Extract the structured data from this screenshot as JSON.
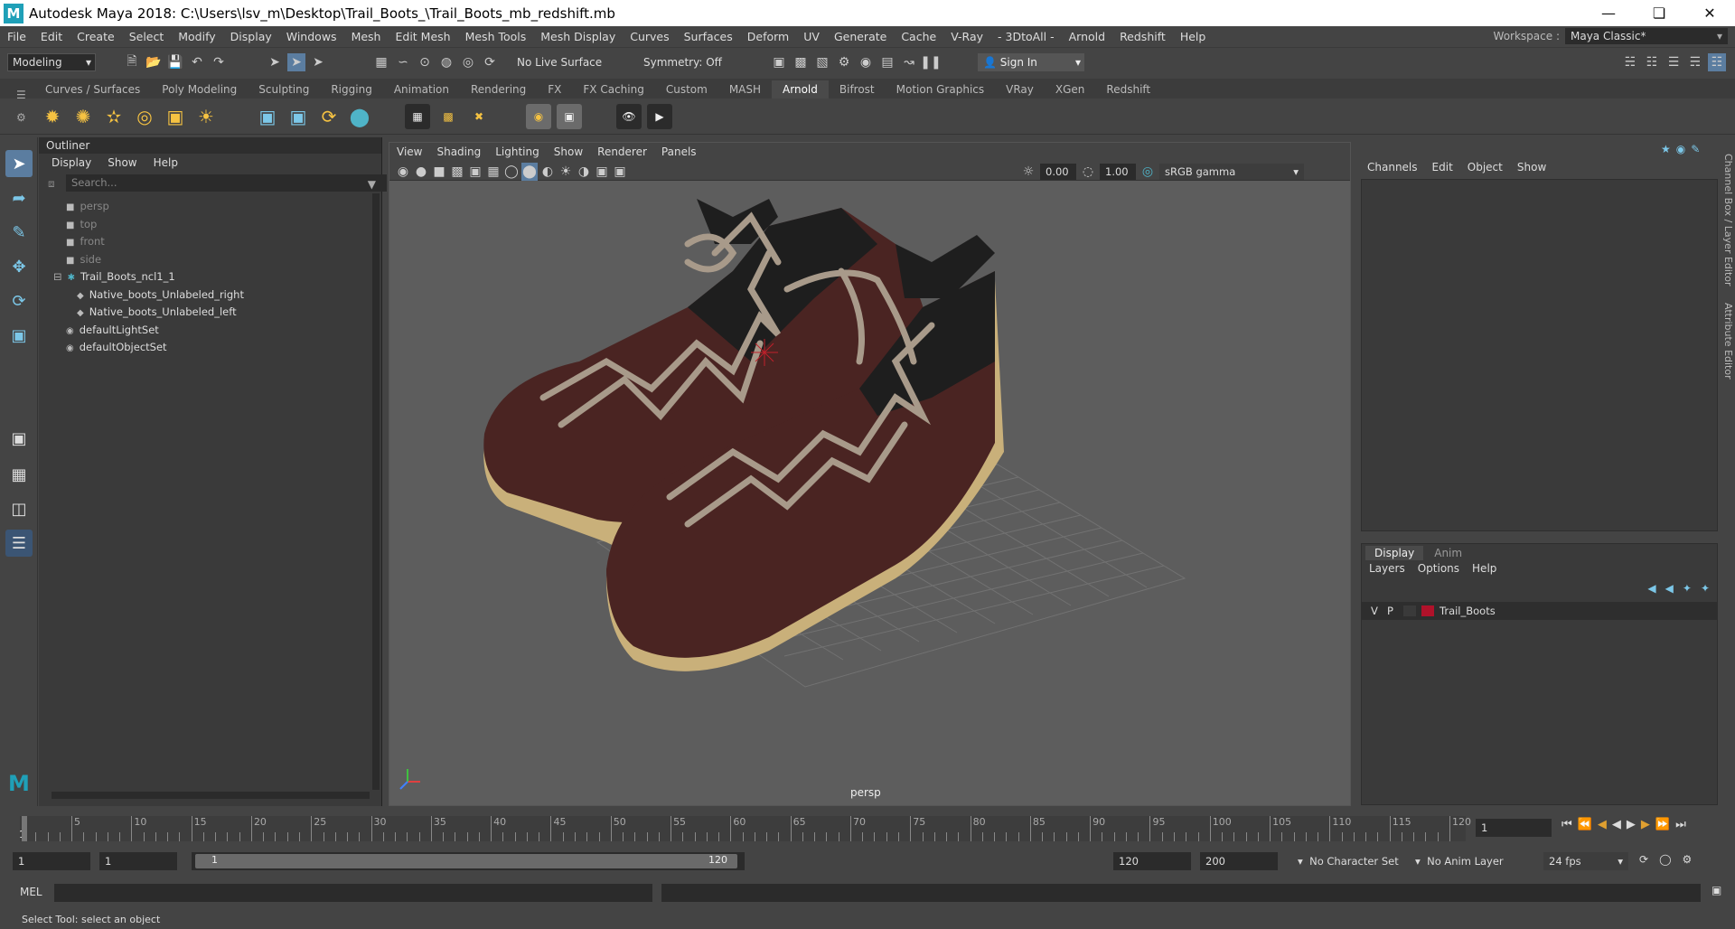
{
  "window": {
    "title": "Autodesk Maya 2018: C:\\Users\\lsv_m\\Desktop\\Trail_Boots_\\Trail_Boots_mb_redshift.mb",
    "app_logo": "M"
  },
  "menubar": [
    "File",
    "Edit",
    "Create",
    "Select",
    "Modify",
    "Display",
    "Windows",
    "Mesh",
    "Edit Mesh",
    "Mesh Tools",
    "Mesh Display",
    "Curves",
    "Surfaces",
    "Deform",
    "UV",
    "Generate",
    "Cache",
    "V-Ray",
    "- 3DtoAll -",
    "Arnold",
    "Redshift",
    "Help"
  ],
  "workspace": {
    "label": "Workspace :",
    "value": "Maya Classic*"
  },
  "statusline": {
    "mode": "Modeling",
    "live_surface": "No Live Surface",
    "symmetry": "Symmetry: Off",
    "sign_in": "Sign In"
  },
  "shelf_tabs": [
    "Curves / Surfaces",
    "Poly Modeling",
    "Sculpting",
    "Rigging",
    "Animation",
    "Rendering",
    "FX",
    "FX Caching",
    "Custom",
    "MASH",
    "Arnold",
    "Bifrost",
    "Motion Graphics",
    "VRay",
    "XGen",
    "Redshift"
  ],
  "shelf_active": "Arnold",
  "outliner": {
    "title": "Outliner",
    "menus": [
      "Display",
      "Show",
      "Help"
    ],
    "search_placeholder": "Search...",
    "items": [
      {
        "label": "persp",
        "icon": "camera-icon",
        "dim": true
      },
      {
        "label": "top",
        "icon": "camera-icon",
        "dim": true
      },
      {
        "label": "front",
        "icon": "camera-icon",
        "dim": true
      },
      {
        "label": "side",
        "icon": "camera-icon",
        "dim": true
      },
      {
        "label": "Trail_Boots_ncl1_1",
        "icon": "group-icon",
        "dim": false
      },
      {
        "label": "Native_boots_Unlabeled_right",
        "icon": "mesh-icon",
        "dim": false
      },
      {
        "label": "Native_boots_Unlabeled_left",
        "icon": "mesh-icon",
        "dim": false
      },
      {
        "label": "defaultLightSet",
        "icon": "set-icon",
        "dim": false
      },
      {
        "label": "defaultObjectSet",
        "icon": "set-icon",
        "dim": false
      }
    ]
  },
  "viewport": {
    "menus": [
      "View",
      "Shading",
      "Lighting",
      "Show",
      "Renderer",
      "Panels"
    ],
    "exposure": "0.00",
    "gamma": "1.00",
    "color_space": "sRGB gamma",
    "camera": "persp"
  },
  "channelbox": {
    "menus": [
      "Channels",
      "Edit",
      "Object",
      "Show"
    ],
    "side_tabs": [
      "Channel Box / Layer Editor",
      "Attribute Editor"
    ]
  },
  "layer_editor": {
    "tabs": [
      "Display",
      "Anim"
    ],
    "menus": [
      "Layers",
      "Options",
      "Help"
    ],
    "layers": [
      {
        "v": "V",
        "p": "P",
        "name": "Trail_Boots",
        "color": "#b0122a"
      }
    ]
  },
  "timeline": {
    "ticks": [
      "1",
      "5",
      "10",
      "15",
      "20",
      "25",
      "30",
      "35",
      "40",
      "45",
      "50",
      "55",
      "60",
      "65",
      "70",
      "75",
      "80",
      "85",
      "90",
      "95",
      "100",
      "105",
      "110",
      "115",
      "120"
    ],
    "current_frame": "1"
  },
  "range": {
    "start": "1",
    "anim_start": "1",
    "range_start": "1",
    "range_end": "120",
    "end": "120",
    "anim_end": "200",
    "character_set": "No Character Set",
    "anim_layer": "No Anim Layer",
    "fps": "24 fps"
  },
  "cmdline": {
    "label": "MEL"
  },
  "helpline": "Select Tool: select an object",
  "colors": {
    "boot_leather": "#4a2422",
    "sole": "#c9b07a",
    "lace": "#a89a8a",
    "layer_color": "#b0122a"
  }
}
